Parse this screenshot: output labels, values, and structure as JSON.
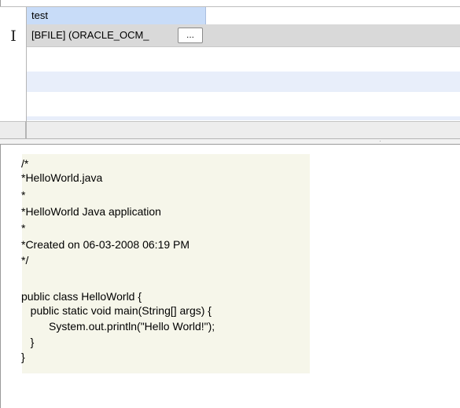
{
  "grid": {
    "column_header": "test",
    "row_1_value": "[BFILE] (ORACLE_OCM_",
    "ellipsis_label": "..."
  },
  "editor": {
    "lines": [
      "/*",
      "*HelloWorld.java",
      "*",
      "*HelloWorld Java application",
      "*",
      "*Created on 06-03-2008 06:19 PM",
      "*/",
      "",
      "public class HelloWorld {",
      "   public static void main(String[] args) {",
      "         System.out.println(\"Hello World!\");",
      "   }",
      "}"
    ]
  },
  "colors": {
    "header_accent": "#c8dcf8",
    "selected_row": "#d9d9d9",
    "alt_row": "#e8eefa",
    "code_background": "#f6f6ea"
  },
  "icons": {
    "row_cursor": "text-cursor-icon"
  }
}
